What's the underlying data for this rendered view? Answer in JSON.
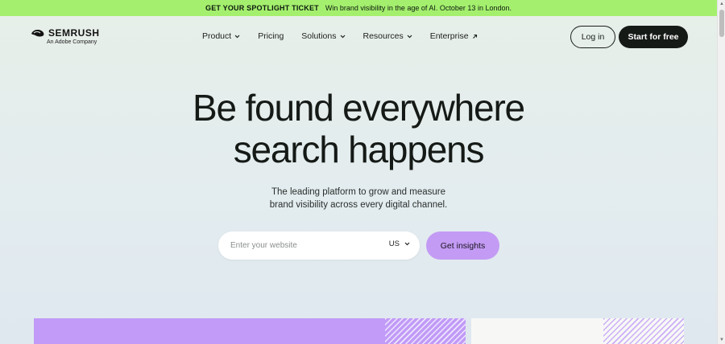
{
  "banner": {
    "strong": "GET YOUR SPOTLIGHT TICKET",
    "text": "Win brand visibility in the age of AI. October 13 in London."
  },
  "brand": {
    "name": "SEMRUSH",
    "sub": "An Adobe Company"
  },
  "nav": {
    "items": [
      {
        "label": "Product",
        "icon": "chevron-down-icon"
      },
      {
        "label": "Pricing",
        "icon": ""
      },
      {
        "label": "Solutions",
        "icon": "chevron-down-icon"
      },
      {
        "label": "Resources",
        "icon": "chevron-down-icon"
      },
      {
        "label": "Enterprise",
        "icon": "external-arrow-icon"
      }
    ],
    "login": "Log in",
    "start": "Start for free"
  },
  "hero": {
    "title_line1": "Be found everywhere",
    "title_line2": "search happens",
    "sub_line1": "The leading platform to grow and measure",
    "sub_line2": "brand visibility across every digital channel."
  },
  "search": {
    "placeholder": "Enter your website",
    "value": "",
    "region": "US",
    "button": "Get insights"
  },
  "colors": {
    "banner": "#a4f06e",
    "accent": "#c39bf4",
    "dark": "#161a17"
  }
}
